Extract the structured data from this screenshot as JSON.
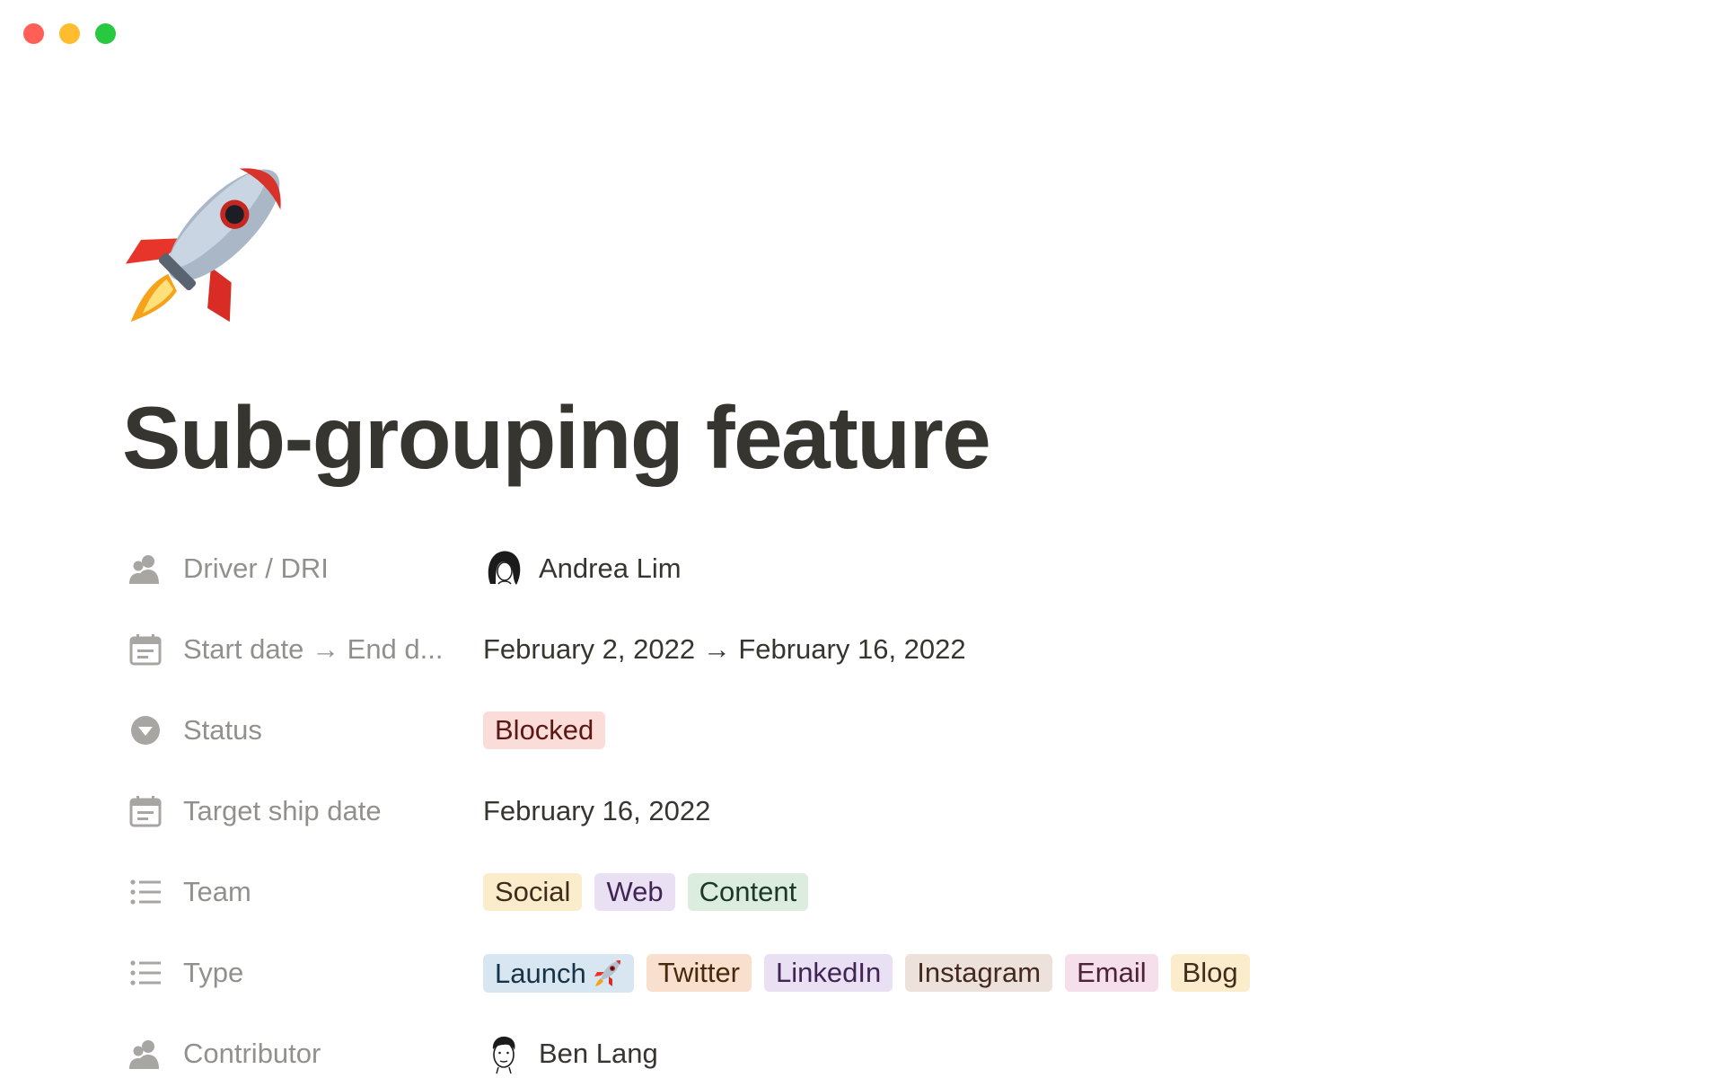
{
  "window": {
    "controls": [
      {
        "name": "close",
        "color": "#ff5f57"
      },
      {
        "name": "minimize",
        "color": "#febc2e"
      },
      {
        "name": "maximize",
        "color": "#28c840"
      }
    ]
  },
  "page": {
    "icon": "rocket-icon",
    "title": "Sub-grouping feature"
  },
  "properties": {
    "driver": {
      "label": "Driver / DRI",
      "icon": "person-icon",
      "value": "Andrea Lim"
    },
    "dates": {
      "label": "Start date → End d...",
      "icon": "calendar-icon",
      "value": "February 2, 2022 → February 16, 2022"
    },
    "status": {
      "label": "Status",
      "icon": "status-icon",
      "value": "Blocked",
      "color": "red"
    },
    "target": {
      "label": "Target ship date",
      "icon": "calendar-icon",
      "value": "February 16, 2022"
    },
    "team": {
      "label": "Team",
      "icon": "list-icon",
      "tags": [
        {
          "text": "Social",
          "color": "yellow"
        },
        {
          "text": "Web",
          "color": "purple"
        },
        {
          "text": "Content",
          "color": "green"
        }
      ]
    },
    "type": {
      "label": "Type",
      "icon": "list-icon",
      "tags": [
        {
          "text": "Launch",
          "color": "blue",
          "emoji": "rocket-icon"
        },
        {
          "text": "Twitter",
          "color": "orange"
        },
        {
          "text": "LinkedIn",
          "color": "purple"
        },
        {
          "text": "Instagram",
          "color": "brown"
        },
        {
          "text": "Email",
          "color": "pink"
        },
        {
          "text": "Blog",
          "color": "yellow"
        }
      ]
    },
    "contributor": {
      "label": "Contributor",
      "icon": "person-icon",
      "value": "Ben Lang"
    }
  }
}
